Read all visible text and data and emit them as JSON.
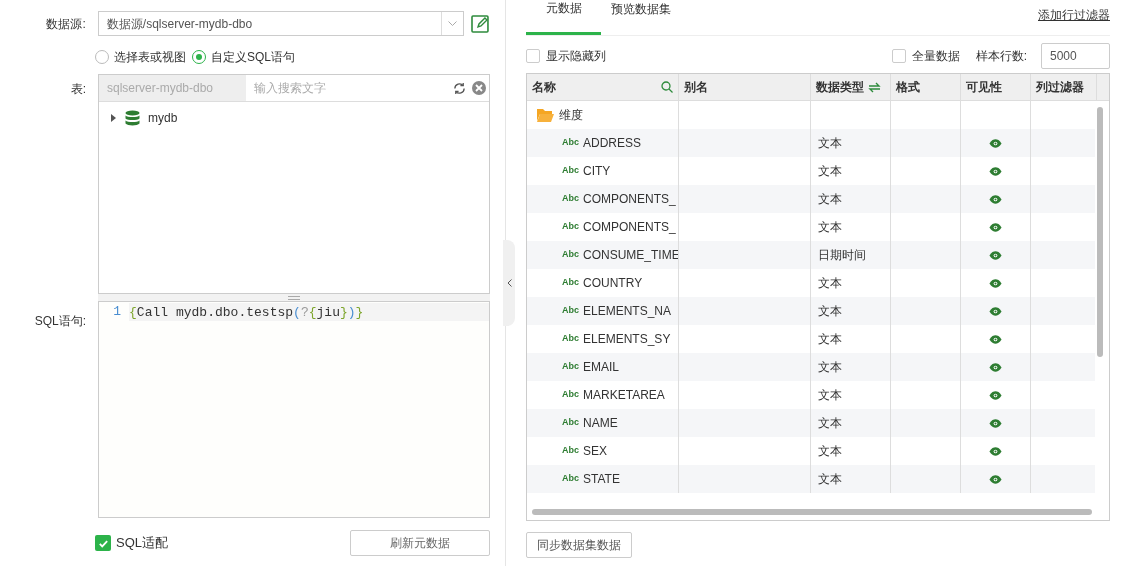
{
  "datasource": {
    "label": "数据源:",
    "value": "数据源/sqlserver-mydb-dbo"
  },
  "source_mode": [
    {
      "label": "选择表或视图",
      "selected": false
    },
    {
      "label": "自定义SQL语句",
      "selected": true
    }
  ],
  "table_picker": {
    "label": "表:",
    "schema": "sqlserver-mydb-dbo",
    "placeholder": "输入搜索文字"
  },
  "tree": [
    {
      "label": "mydb",
      "expanded": false
    }
  ],
  "sql": {
    "label": "SQL语句:",
    "lines": [
      {
        "number": "1",
        "code": "{Call mydb.dbo.testsp(?{jiu})}"
      }
    ]
  },
  "sql_adapt": {
    "label": "SQL适配",
    "checked": true
  },
  "refresh_button": "刷新元数据",
  "tabs": [
    {
      "label": "元数据",
      "selected": true
    },
    {
      "label": "预览数据集",
      "selected": false
    }
  ],
  "add_filter_link": "添加行过滤器",
  "show_hidden": {
    "label": "显示隐藏列",
    "checked": false
  },
  "full_data": {
    "label": "全量数据",
    "checked": false
  },
  "sample_rows": {
    "label": "样本行数:",
    "value": "5000"
  },
  "columns": [
    "名称",
    "别名",
    "数据类型",
    "格式",
    "可见性",
    "列过滤器"
  ],
  "rows": [
    {
      "kind": "folder",
      "label": "维度"
    },
    {
      "kind": "field",
      "badge": "Abc",
      "name": "ADDRESS",
      "data_type": "文本",
      "visible": true
    },
    {
      "kind": "field",
      "badge": "Abc",
      "name": "CITY",
      "data_type": "文本",
      "visible": true
    },
    {
      "kind": "field",
      "badge": "Abc",
      "name": "COMPONENTS_",
      "data_type": "文本",
      "visible": true
    },
    {
      "kind": "field",
      "badge": "Abc",
      "name": "COMPONENTS_",
      "data_type": "文本",
      "visible": true
    },
    {
      "kind": "field",
      "badge": "Abc",
      "name": "CONSUME_TIME",
      "data_type": "日期时间",
      "visible": true
    },
    {
      "kind": "field",
      "badge": "Abc",
      "name": "COUNTRY",
      "data_type": "文本",
      "visible": true
    },
    {
      "kind": "field",
      "badge": "Abc",
      "name": "ELEMENTS_NA",
      "data_type": "文本",
      "visible": true
    },
    {
      "kind": "field",
      "badge": "Abc",
      "name": "ELEMENTS_SY",
      "data_type": "文本",
      "visible": true
    },
    {
      "kind": "field",
      "badge": "Abc",
      "name": "EMAIL",
      "data_type": "文本",
      "visible": true
    },
    {
      "kind": "field",
      "badge": "Abc",
      "name": "MARKETAREA",
      "data_type": "文本",
      "visible": true
    },
    {
      "kind": "field",
      "badge": "Abc",
      "name": "NAME",
      "data_type": "文本",
      "visible": true
    },
    {
      "kind": "field",
      "badge": "Abc",
      "name": "SEX",
      "data_type": "文本",
      "visible": true
    },
    {
      "kind": "field",
      "badge": "Abc",
      "name": "STATE",
      "data_type": "文本",
      "visible": true
    }
  ],
  "sync_button": "同步数据集数据"
}
